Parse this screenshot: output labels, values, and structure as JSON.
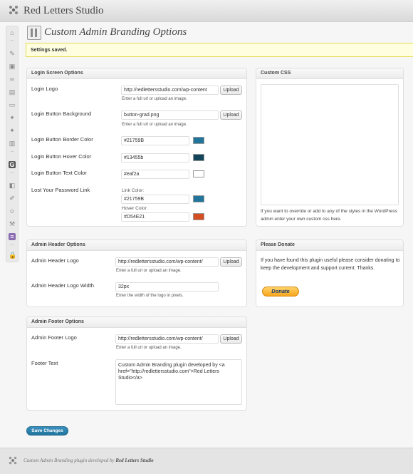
{
  "site": {
    "title": "Red Letters Studio"
  },
  "page": {
    "title": "Custom Admin Branding Options"
  },
  "notice": "Settings saved.",
  "login_box": {
    "title": "Login Screen Options",
    "logo_label": "Login Logo",
    "logo_value": "http://redlettersstudio.com/wp-content",
    "logo_hint": "Enter a full url or upload an image.",
    "btn_bg_label": "Login Button Background",
    "btn_bg_value": "button-grad.png",
    "btn_bg_hint": "Enter a full url or upload an image.",
    "border_color_label": "Login Button Border Color",
    "border_color_value": "#21759B",
    "hover_color_label": "Login Button Hover Color",
    "hover_color_value": "#13455b",
    "text_color_label": "Login Button Text Color",
    "text_color_value": "#eaf2a",
    "lost_pw_label": "Lost Your Password Link",
    "link_color_label": "Link Color:",
    "link_color_value": "#21759B",
    "hover_link_label": "Hover Color:",
    "hover_link_value": "#D54E21",
    "upload_label": "Upload"
  },
  "header_box": {
    "title": "Admin Header Options",
    "logo_label": "Admin Header Logo",
    "logo_value": "http://redlettersstudio.com/wp-content/",
    "logo_hint": "Enter a full url or upload an image.",
    "width_label": "Admin Header Logo Width",
    "width_value": "32px",
    "width_hint": "Enter the width of the logo in pixels.",
    "upload_label": "Upload"
  },
  "footer_box": {
    "title": "Admin Footer Options",
    "logo_label": "Admin Footer Logo",
    "logo_value": "http://redlettersstudio.com/wp-content/",
    "logo_hint": "Enter a full url or upload an image.",
    "text_label": "Footer Text",
    "text_value": "Custom Admin Branding plugin developed by <a href=\"http://redlettersstudio.com\">Red Letters Studio</a>",
    "upload_label": "Upload"
  },
  "css_box": {
    "title": "Custom CSS",
    "help": "If you want to override or add to any of the styles in the WordPress admin enter your own custom css here."
  },
  "donate_box": {
    "title": "Please Donate",
    "text": "If you have found this plugin useful please consider donating to keep the development and support current. Thanks.",
    "button": "Donate"
  },
  "save_button": "Save Changes",
  "footer": {
    "text": "Custom Admin Branding plugin developed by",
    "link": "Red Letters Studio"
  },
  "colors": {
    "border_color": "#21759B",
    "hover_color": "#13455b",
    "text_color": "#ffffff",
    "link_color": "#21759B",
    "hover_link_color": "#D54E21",
    "accent": "#21759b",
    "notice_bg": "#ffffe0"
  },
  "sidebar_icons": [
    "dashboard-icon",
    "posts-icon",
    "media-icon",
    "links-icon",
    "pages-icon",
    "comments-icon",
    "pin-icon",
    "pin-icon",
    "feedback-icon",
    "google-icon",
    "appearance-icon",
    "plugins-icon",
    "users-icon",
    "tools-icon",
    "settings-icon",
    "lock-icon"
  ]
}
